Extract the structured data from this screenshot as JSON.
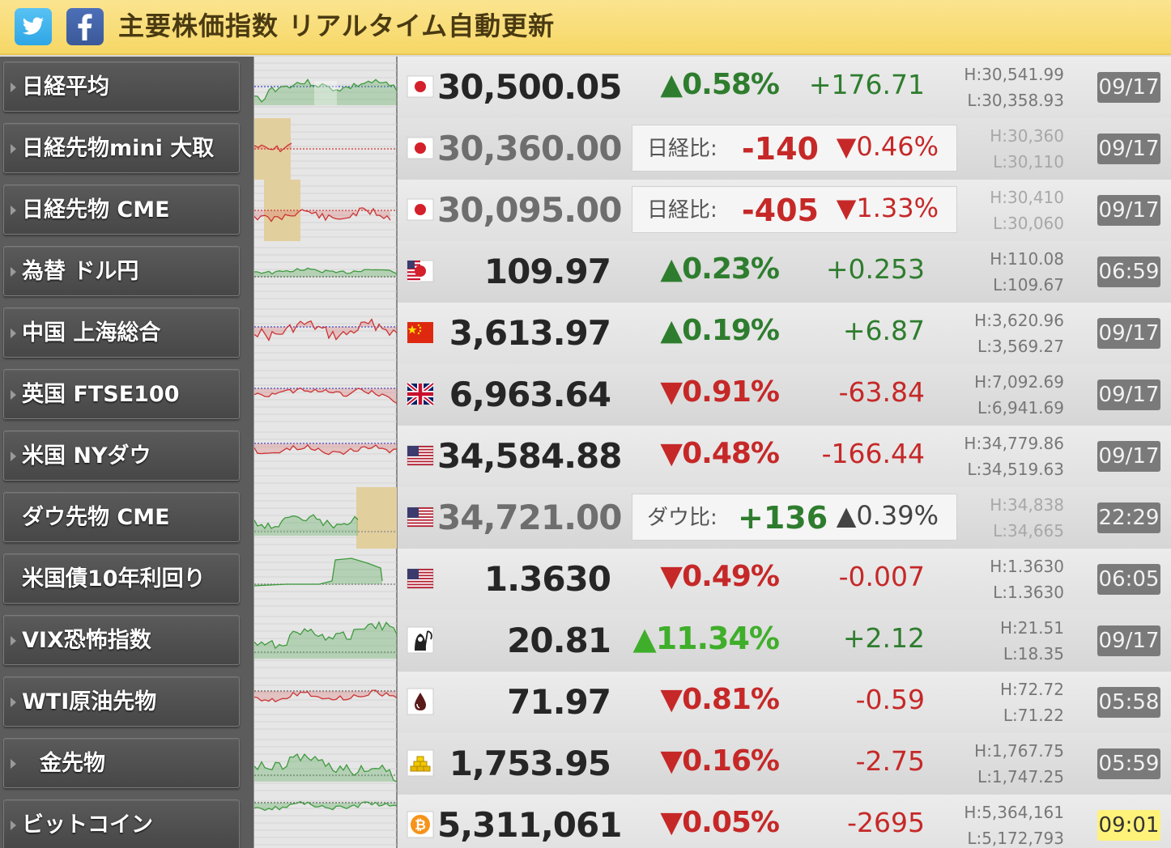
{
  "header": {
    "title": "主要株価指数 リアルタイム自動更新",
    "twitter_icon": "twitter-bird-icon",
    "facebook_icon": "facebook-f-icon"
  },
  "colors": {
    "header_bg": "#f6d766",
    "up_green": "#2e7d2e",
    "down_red": "#c62828",
    "bright_green": "#3fae2a",
    "name_bg": "#4a4a4a"
  },
  "rows": [
    {
      "name": "日経平均",
      "flag": "japan-flag-icon",
      "price": "30,500.05",
      "pct": "▲0.58%",
      "change": "+176.71",
      "high": "H:30,541.99",
      "low": "L:30,358.93",
      "time": "09/17"
    },
    {
      "name": "日経先物mini 大取",
      "flag": "japan-flag-icon",
      "price": "30,360.00",
      "cmp_label": "日経比:",
      "cmp_value": "-140",
      "cmp_pct": "▼0.46%",
      "high": "H:30,360",
      "low": "L:30,110",
      "time": "09/17"
    },
    {
      "name": "日経先物 CME",
      "flag": "japan-flag-icon",
      "price": "30,095.00",
      "cmp_label": "日経比:",
      "cmp_value": "-405",
      "cmp_pct": "▼1.33%",
      "high": "H:30,410",
      "low": "L:30,060",
      "time": "09/17"
    },
    {
      "name": "為替 ドル円",
      "flag": "usd-jpy-flag-icon",
      "price": "109.97",
      "pct": "▲0.23%",
      "change": "+0.253",
      "high": "H:110.08",
      "low": "L:109.67",
      "time": "06:59"
    },
    {
      "name": "中国 上海総合",
      "flag": "china-flag-icon",
      "price": "3,613.97",
      "pct": "▲0.19%",
      "change": "+6.87",
      "high": "H:3,620.96",
      "low": "L:3,569.27",
      "time": "09/17"
    },
    {
      "name": "英国 FTSE100",
      "flag": "uk-flag-icon",
      "price": "6,963.64",
      "pct": "▼0.91%",
      "change": "-63.84",
      "high": "H:7,092.69",
      "low": "L:6,941.69",
      "time": "09/17"
    },
    {
      "name": "米国 NYダウ",
      "flag": "us-flag-icon",
      "price": "34,584.88",
      "pct": "▼0.48%",
      "change": "-166.44",
      "high": "H:34,779.86",
      "low": "L:34,519.63",
      "time": "09/17"
    },
    {
      "name": "ダウ先物 CME",
      "flag": "us-flag-icon",
      "price": "34,721.00",
      "cmp_label": "ダウ比:",
      "cmp_value": "+136",
      "cmp_pct": "▲0.39%",
      "high": "H:34,838",
      "low": "L:34,665",
      "time": "22:29"
    },
    {
      "name": "米国債10年利回り",
      "flag": "us-flag-icon",
      "price": "1.3630",
      "pct": "▼0.49%",
      "change": "-0.007",
      "high": "H:1.3630",
      "low": "L:1.3630",
      "time": "06:05"
    },
    {
      "name": "VIX恐怖指数",
      "flag": "reaper-icon",
      "price": "20.81",
      "pct": "▲11.34%",
      "change": "+2.12",
      "high": "H:21.51",
      "low": "L:18.35",
      "time": "09/17"
    },
    {
      "name": "WTI原油先物",
      "flag": "oil-drop-icon",
      "price": "71.97",
      "pct": "▼0.81%",
      "change": "-0.59",
      "high": "H:72.72",
      "low": "L:71.22",
      "time": "05:58"
    },
    {
      "name": "金先物",
      "flag": "gold-bars-icon",
      "price": "1,753.95",
      "pct": "▼0.16%",
      "change": "-2.75",
      "high": "H:1,767.75",
      "low": "L:1,747.25",
      "time": "05:59"
    },
    {
      "name": "ビットコイン",
      "flag": "bitcoin-icon",
      "price": "5,311,061",
      "pct": "▼0.05%",
      "change": "-2695",
      "high": "H:5,364,161",
      "low": "L:5,172,793",
      "time": "09:01"
    }
  ]
}
